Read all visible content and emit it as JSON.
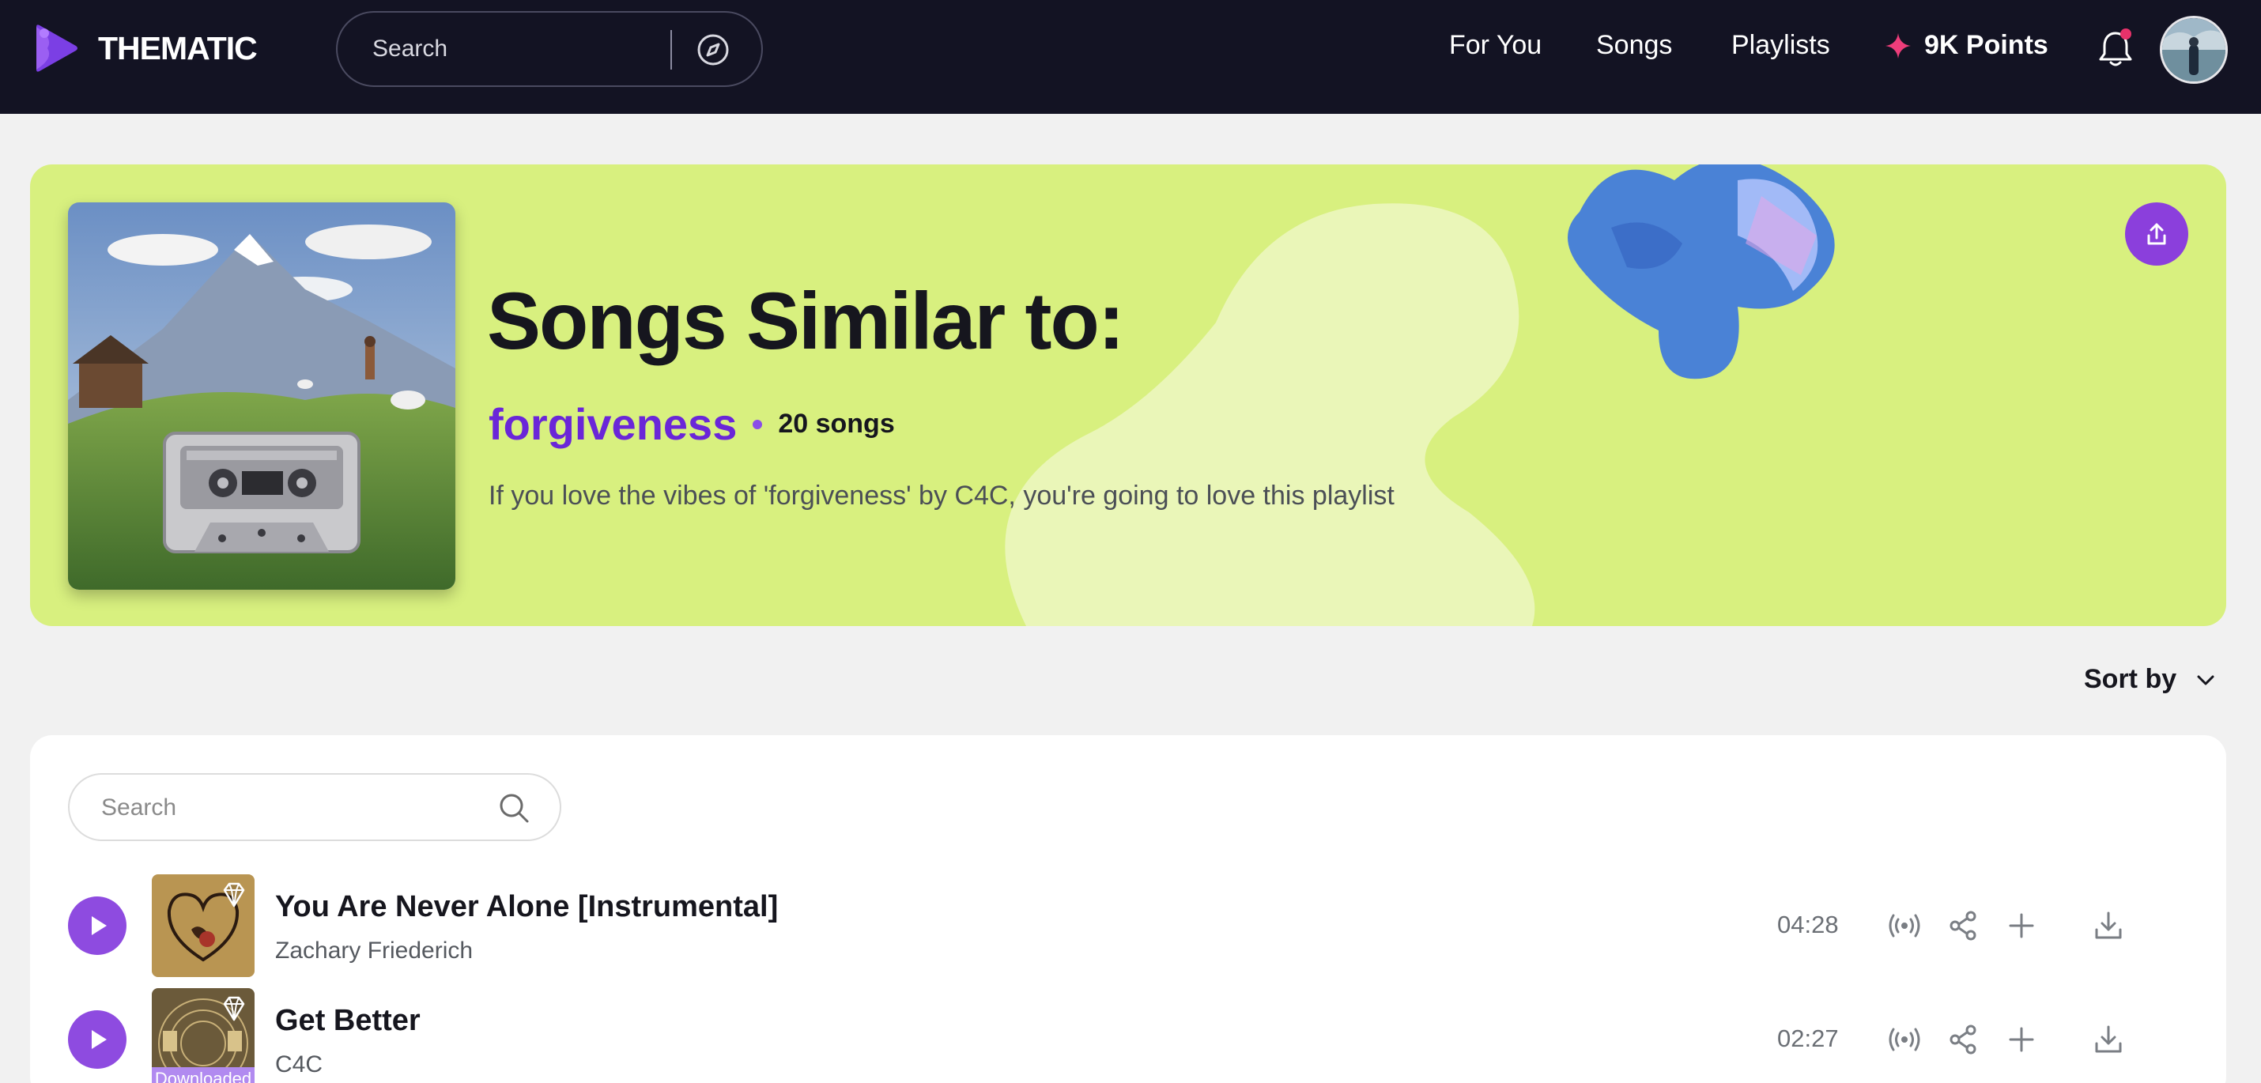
{
  "app": {
    "name": "THEMATIC",
    "brand_color": "#8b3fdc",
    "nav_bg": "#131323",
    "hero_bg": "#d8f07f"
  },
  "nav": {
    "search_placeholder": "Search",
    "links": [
      "For You",
      "Songs",
      "Playlists"
    ],
    "points": "9K Points",
    "has_notification": true
  },
  "hero": {
    "title": "Songs Similar to:",
    "song": "forgiveness",
    "count": "20 songs",
    "description": "If you love the vibes of 'forgiveness' by C4C, you're going to love this playlist"
  },
  "sort": {
    "label": "Sort by"
  },
  "list": {
    "search_placeholder": "Search",
    "songs": [
      {
        "title": "You Are Never Alone [Instrumental]",
        "artist": "Zachary Friederich",
        "duration": "04:28",
        "premium": true,
        "downloaded": false
      },
      {
        "title": "Get Better",
        "artist": "C4C",
        "duration": "02:27",
        "premium": true,
        "downloaded": true,
        "badge": "Downloaded"
      }
    ]
  }
}
